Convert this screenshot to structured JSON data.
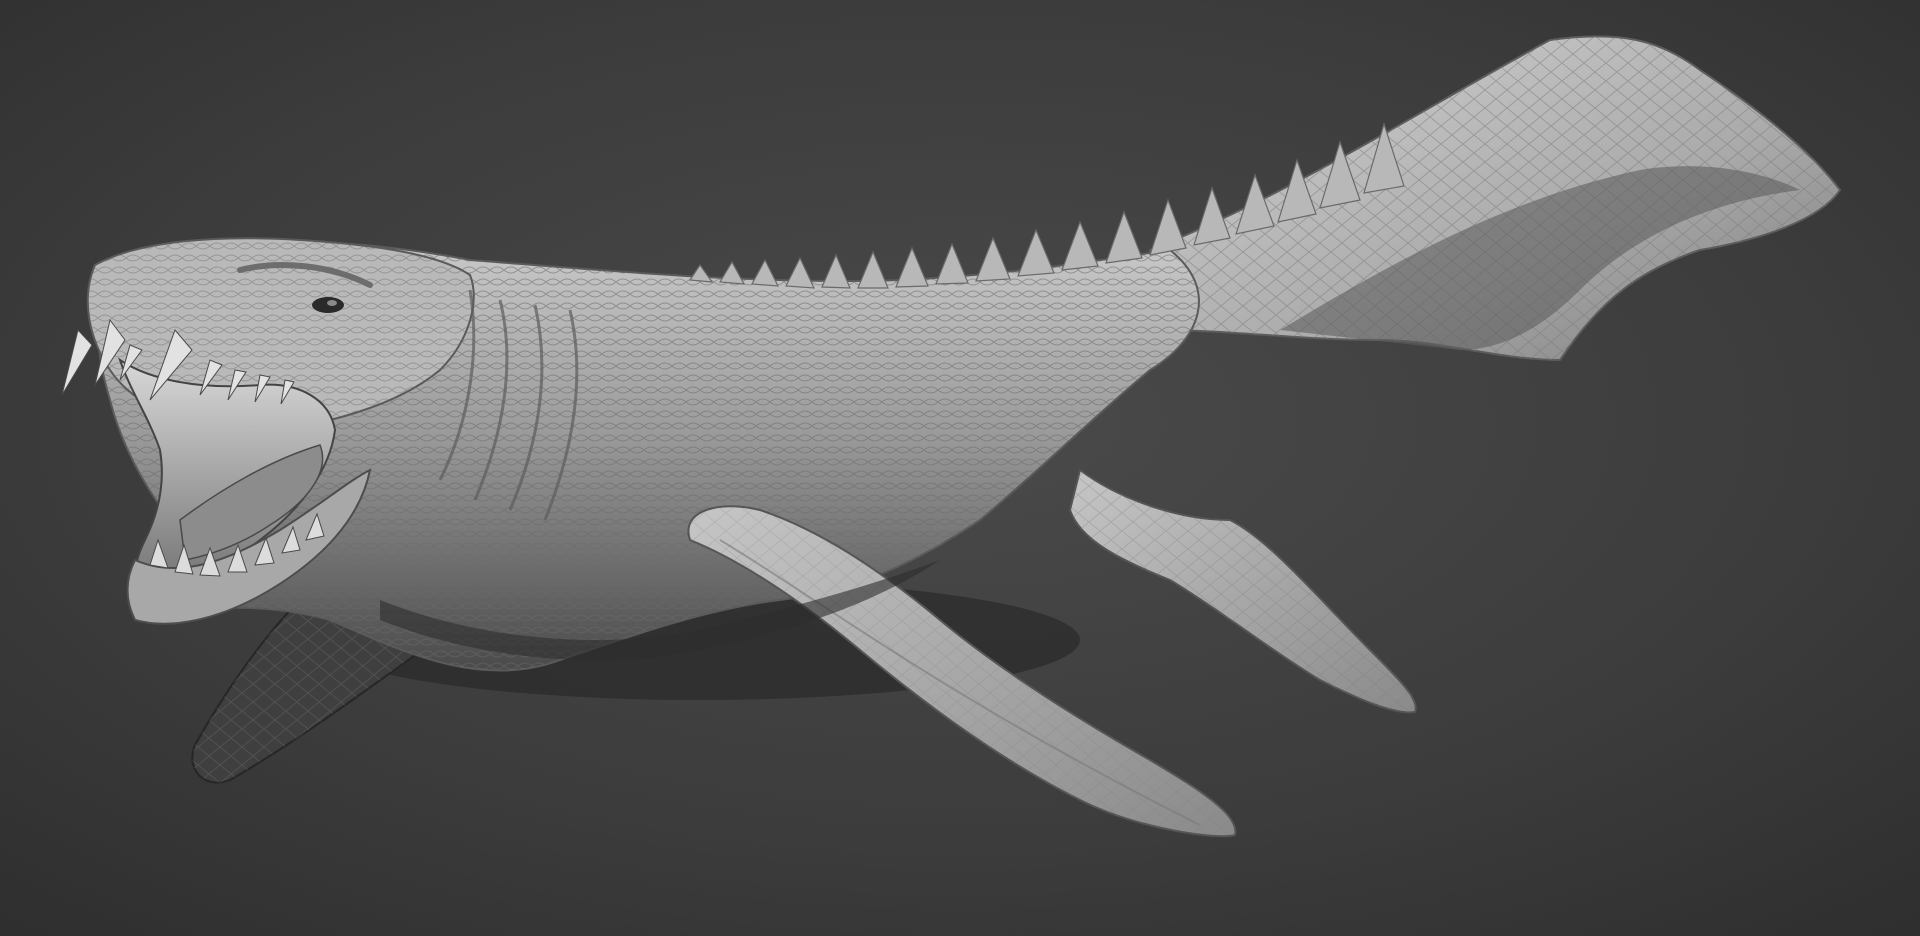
{
  "viewport": {
    "background_top": "#333333",
    "background_mid": "#454545",
    "background_bottom": "#313131"
  },
  "model": {
    "subject": "sea-reptile-sculpt",
    "material_colors": {
      "highlight": "#d9d9d9",
      "base": "#9d9d9d",
      "shade": "#5e5e5e",
      "deep_shade": "#2c2c2c"
    }
  }
}
